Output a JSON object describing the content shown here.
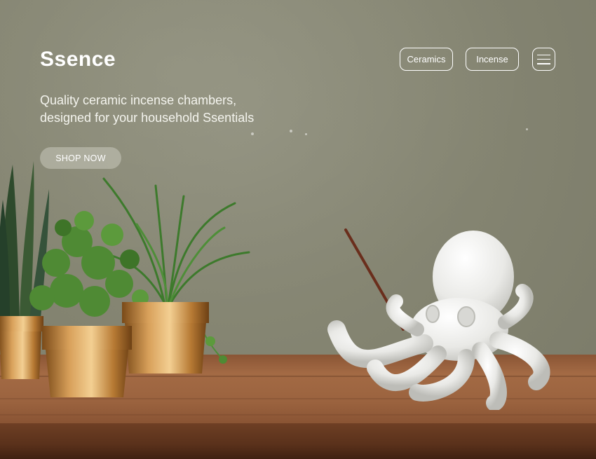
{
  "brand": {
    "name": "Ssence"
  },
  "hero": {
    "tagline_line1": "Quality ceramic incense chambers,",
    "tagline_line2": "designed for your household Ssentials",
    "cta_label": "SHOP NOW"
  },
  "nav": {
    "ceramics_label": "Ceramics",
    "incense_label": "Incense",
    "menu_icon": "hamburger-menu-icon"
  },
  "colors": {
    "wall": "#858572",
    "table": "#9b633f",
    "text": "#ffffff"
  }
}
